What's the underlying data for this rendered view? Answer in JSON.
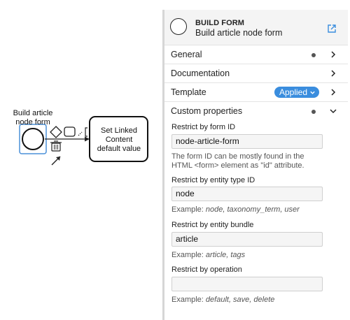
{
  "canvas": {
    "start_event_label": "Build article node form",
    "task_label": "Set Linked Content default value"
  },
  "panel": {
    "header": {
      "type": "BUILD FORM",
      "name": "Build article node form"
    },
    "groups": {
      "general": "General",
      "documentation": "Documentation",
      "template": "Template",
      "template_badge": "Applied",
      "custom": "Custom properties"
    },
    "fields": {
      "form_id": {
        "label": "Restrict by form ID",
        "value": "node-article-form",
        "hint": "The form ID can be mostly found in the HTML <form> element as \"id\" attribute."
      },
      "entity_type": {
        "label": "Restrict by entity type ID",
        "value": "node",
        "hint_prefix": "Example: ",
        "hint_example": "node, taxonomy_term, user"
      },
      "bundle": {
        "label": "Restrict by entity bundle",
        "value": "article",
        "hint_prefix": "Example: ",
        "hint_example": "article, tags"
      },
      "operation": {
        "label": "Restrict by operation",
        "value": "",
        "hint_prefix": "Example: ",
        "hint_example": "default, save, delete"
      }
    }
  },
  "colors": {
    "accent": "#3a8dde",
    "selection": "#4a90d9",
    "header_bg": "#f4f4f4"
  }
}
